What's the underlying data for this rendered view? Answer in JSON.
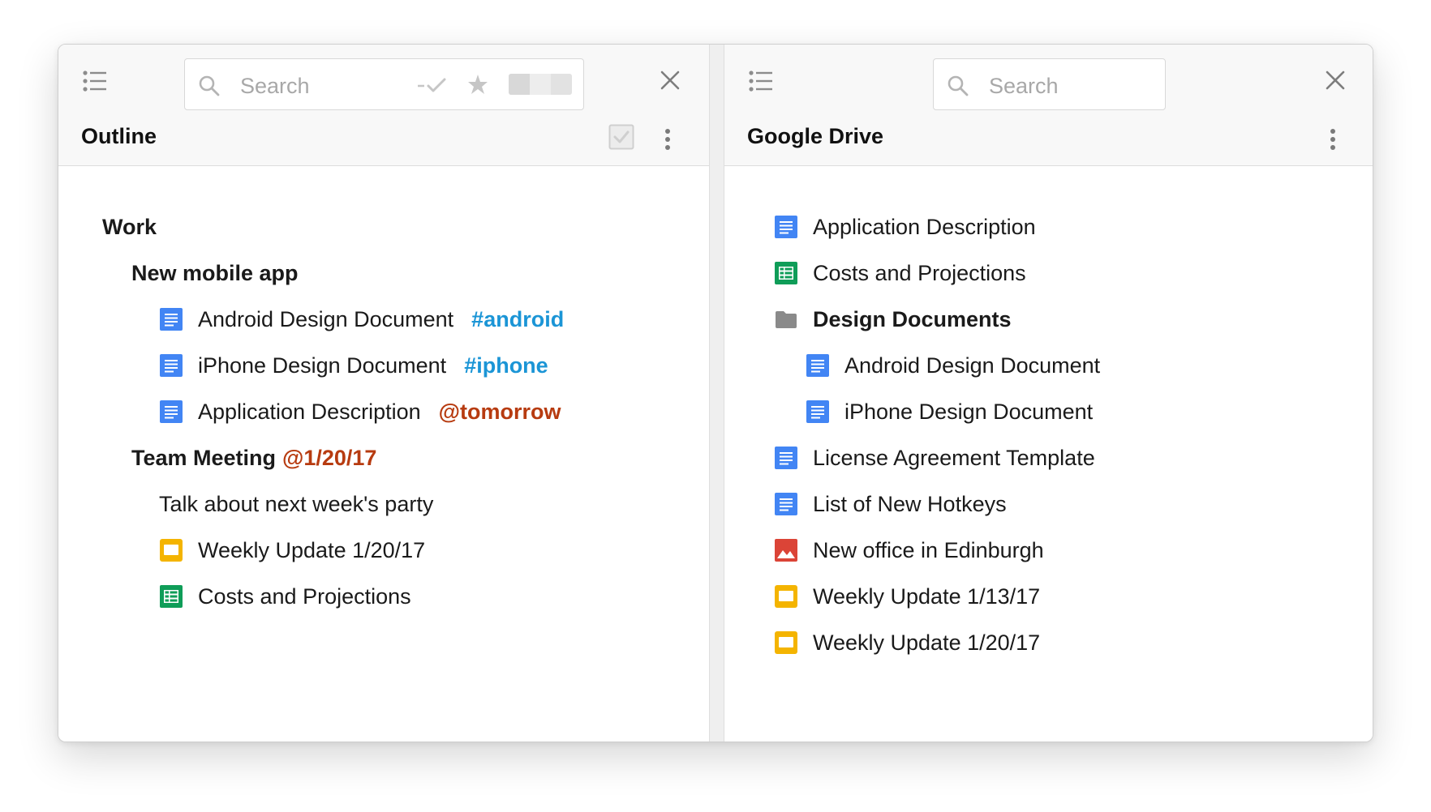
{
  "outline_pane": {
    "search": {
      "placeholder": "Search"
    },
    "title": "Outline",
    "items": [
      {
        "text": "Work"
      },
      {
        "text": "New mobile app"
      },
      {
        "text": "Android Design Document",
        "tag": "#android"
      },
      {
        "text": "iPhone Design Document",
        "tag": "#iphone"
      },
      {
        "text": "Application Description",
        "tag": "@tomorrow"
      },
      {
        "text": "Team Meeting",
        "tag": "@1/20/17"
      },
      {
        "text": "Talk about next week's party"
      },
      {
        "text": "Weekly Update 1/20/17"
      },
      {
        "text": "Costs and Projections"
      }
    ]
  },
  "drive_pane": {
    "search": {
      "placeholder": "Search"
    },
    "title": "Google Drive",
    "items": [
      {
        "text": "Application Description"
      },
      {
        "text": "Costs and Projections"
      },
      {
        "text": "Design Documents"
      },
      {
        "text": "Android Design Document"
      },
      {
        "text": "iPhone Design Document"
      },
      {
        "text": "License Agreement Template"
      },
      {
        "text": "List of New Hotkeys"
      },
      {
        "text": "New office in Edinburgh"
      },
      {
        "text": "Weekly Update 1/13/17"
      },
      {
        "text": "Weekly Update 1/20/17"
      }
    ]
  },
  "icons": {
    "doc": "google-docs-icon",
    "sheet": "google-sheets-icon",
    "slides": "google-slides-icon",
    "drawing": "image-file-icon",
    "folder": "folder-icon"
  },
  "colors": {
    "docs_blue": "#4285f4",
    "sheets_green": "#0f9d58",
    "slides_yellow": "#f4b400",
    "image_red": "#db4437",
    "folder_gray": "#8a8a8a",
    "hashtag_blue": "#1b95d6",
    "mention_red": "#b73b10"
  }
}
